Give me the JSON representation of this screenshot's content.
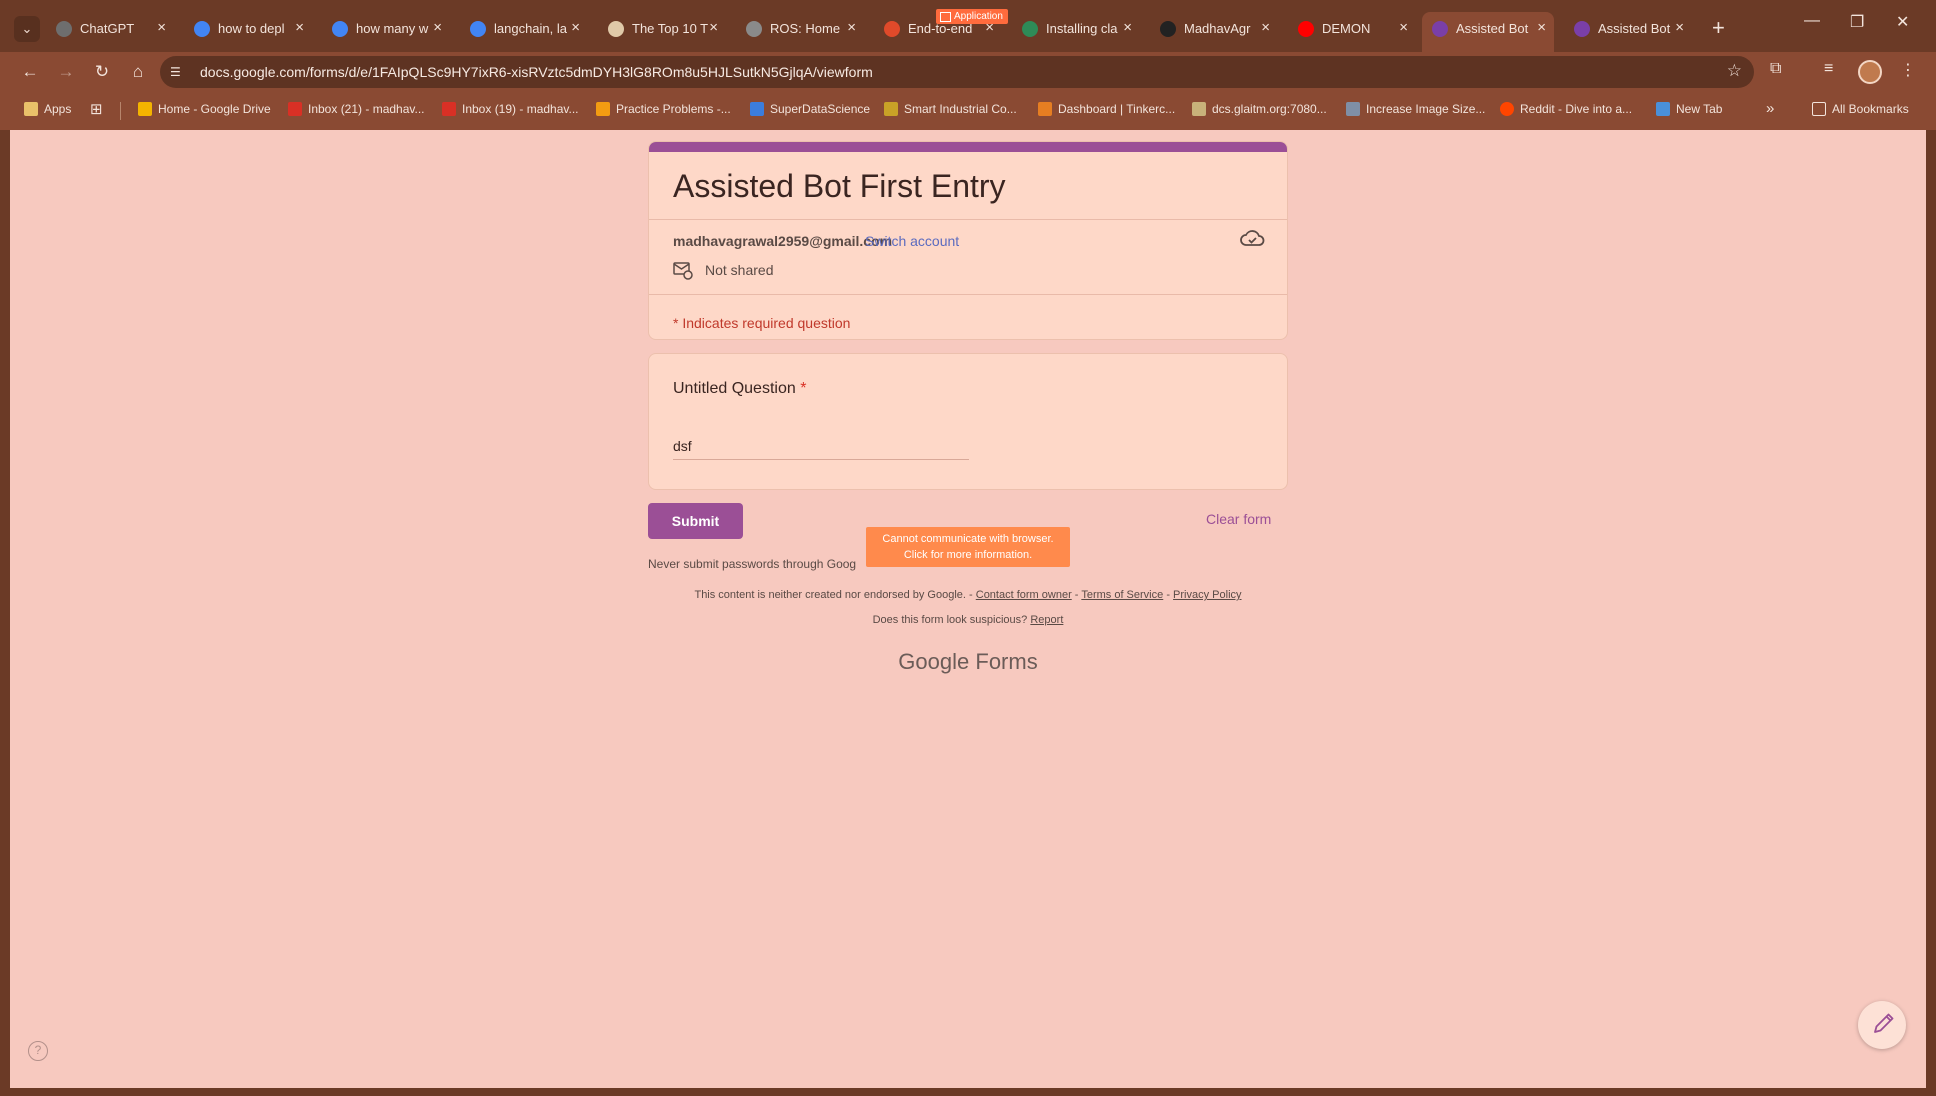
{
  "browser": {
    "tabs": [
      {
        "title": "ChatGPT",
        "icon": "chatgpt-icon",
        "color": "#6e6e6e"
      },
      {
        "title": "how to depl",
        "icon": "google-icon",
        "color": "#4285f4"
      },
      {
        "title": "how many w",
        "icon": "google-icon",
        "color": "#4285f4"
      },
      {
        "title": "langchain, la",
        "icon": "google-icon",
        "color": "#4285f4"
      },
      {
        "title": "The Top 10 T",
        "icon": "page-icon",
        "color": "#e0c9a8"
      },
      {
        "title": "ROS: Home",
        "icon": "ros-icon",
        "color": "#8a8a8a"
      },
      {
        "title": "End-to-end",
        "icon": "udemy-icon",
        "color": "#e04a2a"
      },
      {
        "title": "Installing cla",
        "icon": "infinity-icon",
        "color": "#2e8b57"
      },
      {
        "title": "MadhavAgr",
        "icon": "github-icon",
        "color": "#222222"
      },
      {
        "title": "DEMON",
        "icon": "youtube-icon",
        "color": "#ff0000"
      },
      {
        "title": "Assisted Bot",
        "icon": "forms-icon",
        "color": "#7a3fa8",
        "active": true
      },
      {
        "title": "Assisted Bot",
        "icon": "forms-icon",
        "color": "#7a3fa8"
      }
    ],
    "app_badge": "Application",
    "url": "docs.google.com/forms/d/e/1FAIpQLSc9HY7ixR6-xisRVztc5dmDYH3lG8ROm8u5HJLSutkN5GjlqA/viewform",
    "bookmarks": [
      {
        "label": "Apps",
        "icon": "apps-icon"
      },
      {
        "label": "Home - Google Drive",
        "icon": "drive-icon"
      },
      {
        "label": "Inbox (21) - madhav...",
        "icon": "gmail-icon"
      },
      {
        "label": "Inbox (19) - madhav...",
        "icon": "gmail-icon"
      },
      {
        "label": "Practice Problems -...",
        "icon": "cc-icon"
      },
      {
        "label": "SuperDataScience",
        "icon": "sds-icon"
      },
      {
        "label": "Smart Industrial Co...",
        "icon": "site-icon"
      },
      {
        "label": "Dashboard | Tinkerc...",
        "icon": "tinkercad-icon"
      },
      {
        "label": "dcs.glaitm.org:7080...",
        "icon": "site-icon"
      },
      {
        "label": "Increase Image Size...",
        "icon": "image-icon"
      },
      {
        "label": "Reddit - Dive into a...",
        "icon": "reddit-icon"
      },
      {
        "label": "New Tab",
        "icon": "newtab-icon"
      }
    ],
    "all_bookmarks": "All Bookmarks"
  },
  "form": {
    "title": "Assisted Bot First Entry",
    "account_email": "madhavagrawal2959@gmail.com",
    "switch_account": "Switch account",
    "not_shared": "Not shared",
    "required_note": "* Indicates required question",
    "question": {
      "label": "Untitled Question",
      "required_mark": "*",
      "answer": "dsf"
    },
    "submit": "Submit",
    "clear": "Clear form",
    "never_submit": "Never submit passwords through Goog",
    "tooltip_line1": "Cannot communicate with browser.",
    "tooltip_line2": "Click for more information.",
    "disclaimer_prefix": "This content is neither created nor endorsed by Google. -",
    "contact_owner": "Contact form owner",
    "terms": "Terms of Service",
    "privacy": "Privacy Policy",
    "suspicious": "Does this form look suspicious?",
    "report": "Report",
    "logo_google": "Google",
    "logo_forms": "Forms"
  },
  "colors": {
    "accent": "#9b4f96",
    "page_bg": "#f7c9bf",
    "card_bg": "#fed8c8",
    "chrome": "#6b3a26",
    "error": "#c0392b"
  }
}
